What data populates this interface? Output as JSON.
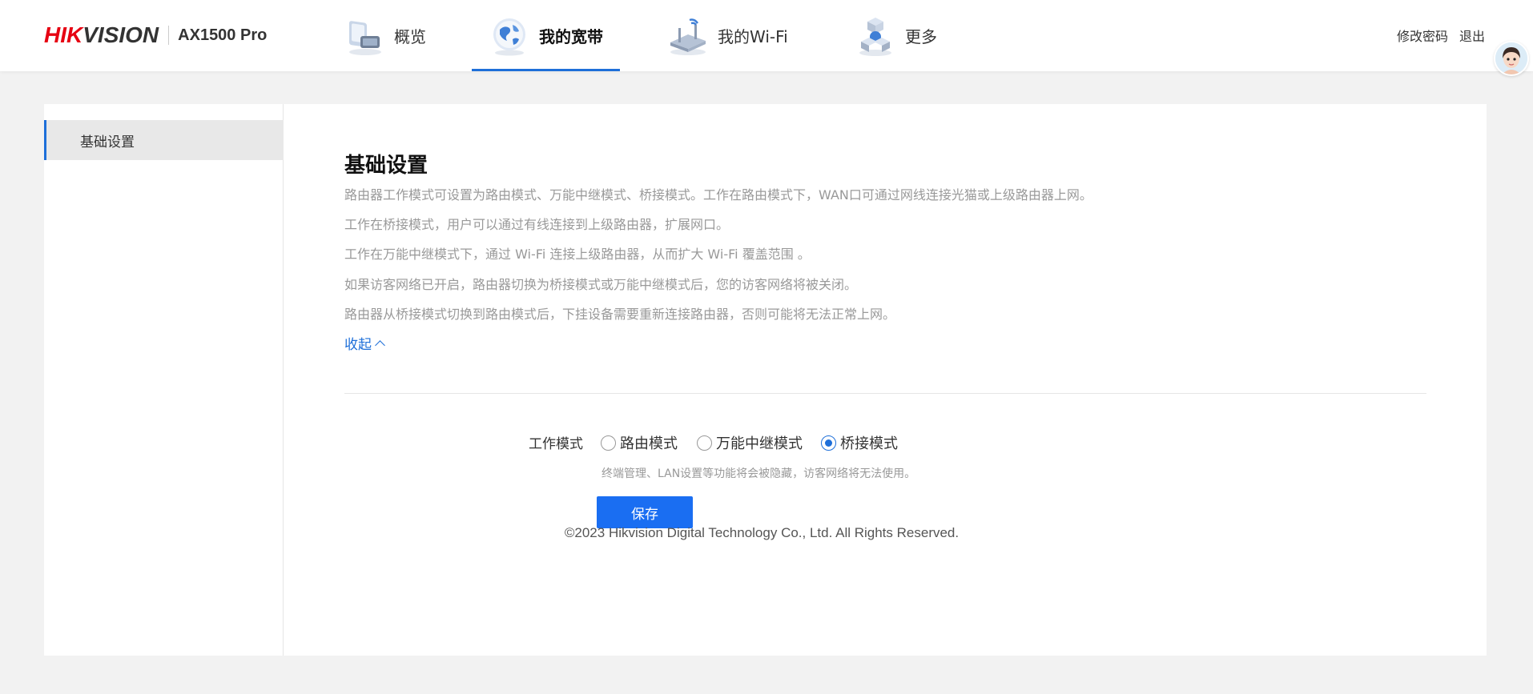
{
  "header": {
    "brand_red": "HIK",
    "brand_dark": "VISION",
    "model": "AX1500 Pro",
    "nav": [
      {
        "label": "概览",
        "icon": "monitor-icon"
      },
      {
        "label": "我的宽带",
        "icon": "globe-icon",
        "active": true
      },
      {
        "label": "我的Wi-Fi",
        "icon": "router-icon"
      },
      {
        "label": "更多",
        "icon": "cubes-icon"
      }
    ],
    "change_password": "修改密码",
    "logout": "退出"
  },
  "sidebar": {
    "items": [
      {
        "label": "基础设置",
        "active": true
      }
    ]
  },
  "main": {
    "title": "基础设置",
    "descriptions": [
      "路由器工作模式可设置为路由模式、万能中继模式、桥接模式。工作在路由模式下，WAN口可通过网线连接光猫或上级路由器上网。",
      "工作在桥接模式，用户可以通过有线连接到上级路由器，扩展网口。",
      "工作在万能中继模式下，通过 Wi-Fi 连接上级路由器，从而扩大 Wi-Fi 覆盖范围 。",
      "如果访客网络已开启，路由器切换为桥接模式或万能中继模式后，您的访客网络将被关闭。",
      "路由器从桥接模式切换到路由模式后，下挂设备需要重新连接路由器，否则可能将无法正常上网。"
    ],
    "collapse_label": "收起",
    "work_mode_label": "工作模式",
    "modes": [
      {
        "label": "路由模式",
        "checked": false
      },
      {
        "label": "万能中继模式",
        "checked": false
      },
      {
        "label": "桥接模式",
        "checked": true
      }
    ],
    "hint": "终端管理、LAN设置等功能将会被隐藏，访客网络将无法使用。",
    "save_label": "保存"
  },
  "footer": {
    "copyright": "©2023 Hikvision Digital Technology Co., Ltd. All Rights Reserved."
  },
  "colors": {
    "accent": "#1e6fd9",
    "brand_red": "#e60012",
    "button": "#1a6ef2"
  }
}
